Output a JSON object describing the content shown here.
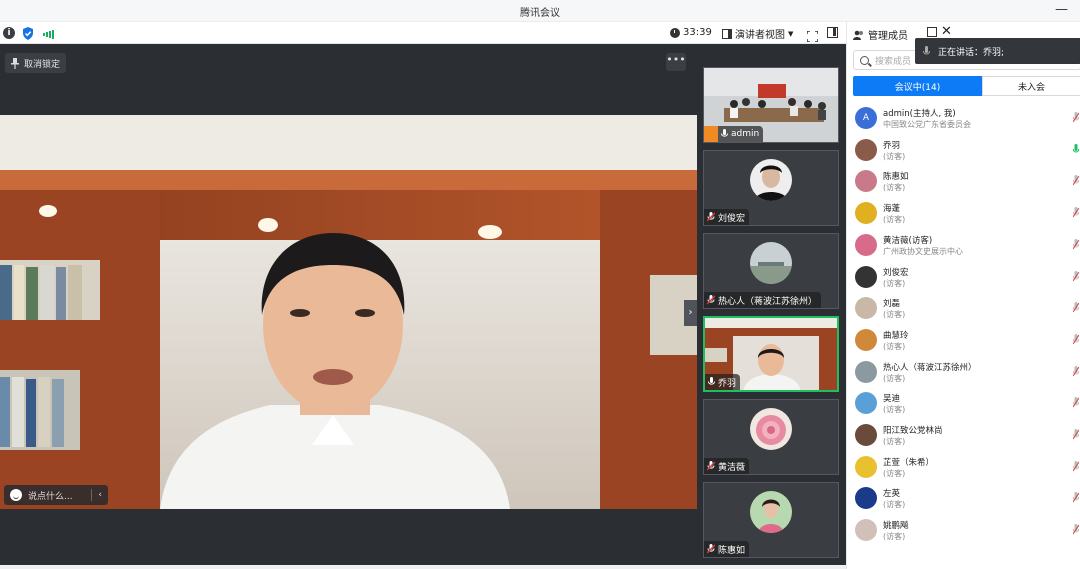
{
  "app": {
    "title": "腾讯会议"
  },
  "toolbar": {
    "timer": "33:39",
    "view_label": "演讲者视图"
  },
  "stage": {
    "unpin_label": "取消锁定",
    "more_label": "•••",
    "chat_placeholder": "说点什么...",
    "chat_collapse": "‹"
  },
  "thumbnails": [
    {
      "name": "admin",
      "kind": "room"
    },
    {
      "name": "刘俊宏",
      "kind": "avatar"
    },
    {
      "name": "热心人（蒋波江苏徐州）",
      "kind": "avatar"
    },
    {
      "name": "乔羽",
      "kind": "video",
      "active": true
    },
    {
      "name": "黄洁薇",
      "kind": "avatar"
    },
    {
      "name": "陈惠如",
      "kind": "avatar"
    }
  ],
  "panel": {
    "title": "管理成员",
    "speaking_label": "正在讲话：乔羽;",
    "search_placeholder": "搜索成员",
    "tab_in": "会议中(14)",
    "tab_out": "未入会",
    "members": [
      {
        "name": "admin(主持人, 我)",
        "sub": "中国致公党广东省委员会",
        "avatar_text": "A",
        "color": "#3a6fd8",
        "mic": "muted"
      },
      {
        "name": "乔羽",
        "sub": "(访客)",
        "avatar_text": "",
        "color": "#8a5a4a",
        "mic": "active"
      },
      {
        "name": "陈惠如",
        "sub": "(访客)",
        "avatar_text": "",
        "color": "#c97a8a",
        "mic": "muted"
      },
      {
        "name": "海蓬",
        "sub": "(访客)",
        "avatar_text": "",
        "color": "#e0b020",
        "mic": "muted"
      },
      {
        "name": "黄洁薇(访客)",
        "sub": "广州政协文史展示中心",
        "avatar_text": "",
        "color": "#d86a8a",
        "mic": "muted"
      },
      {
        "name": "刘俊宏",
        "sub": "(访客)",
        "avatar_text": "",
        "color": "#333333",
        "mic": "muted"
      },
      {
        "name": "刘磊",
        "sub": "(访客)",
        "avatar_text": "",
        "color": "#c9b8a8",
        "mic": "muted"
      },
      {
        "name": "曲慧玲",
        "sub": "(访客)",
        "avatar_text": "",
        "color": "#d0893a",
        "mic": "muted"
      },
      {
        "name": "热心人（蒋波江苏徐州）",
        "sub": "(访客)",
        "avatar_text": "",
        "color": "#8a9aa0",
        "mic": "muted"
      },
      {
        "name": "吴迪",
        "sub": "(访客)",
        "avatar_text": "",
        "color": "#5aa0d8",
        "mic": "muted"
      },
      {
        "name": "阳江致公党林尚",
        "sub": "(访客)",
        "avatar_text": "",
        "color": "#6a4a3a",
        "mic": "muted"
      },
      {
        "name": "芷萱（朱希）",
        "sub": "(访客)",
        "avatar_text": "",
        "color": "#e8c030",
        "mic": "muted"
      },
      {
        "name": "左英",
        "sub": "(访客)",
        "avatar_text": "",
        "color": "#1a3a8a",
        "mic": "muted"
      },
      {
        "name": "姚鹏飚",
        "sub": "(访客)",
        "avatar_text": "",
        "color": "#d0c0b8",
        "mic": "muted"
      }
    ]
  },
  "colors": {
    "accent": "#0e7bf6",
    "active_border": "#1fbf5f",
    "muted_mic": "#e0343a",
    "stage_bg": "#2b2e33"
  }
}
